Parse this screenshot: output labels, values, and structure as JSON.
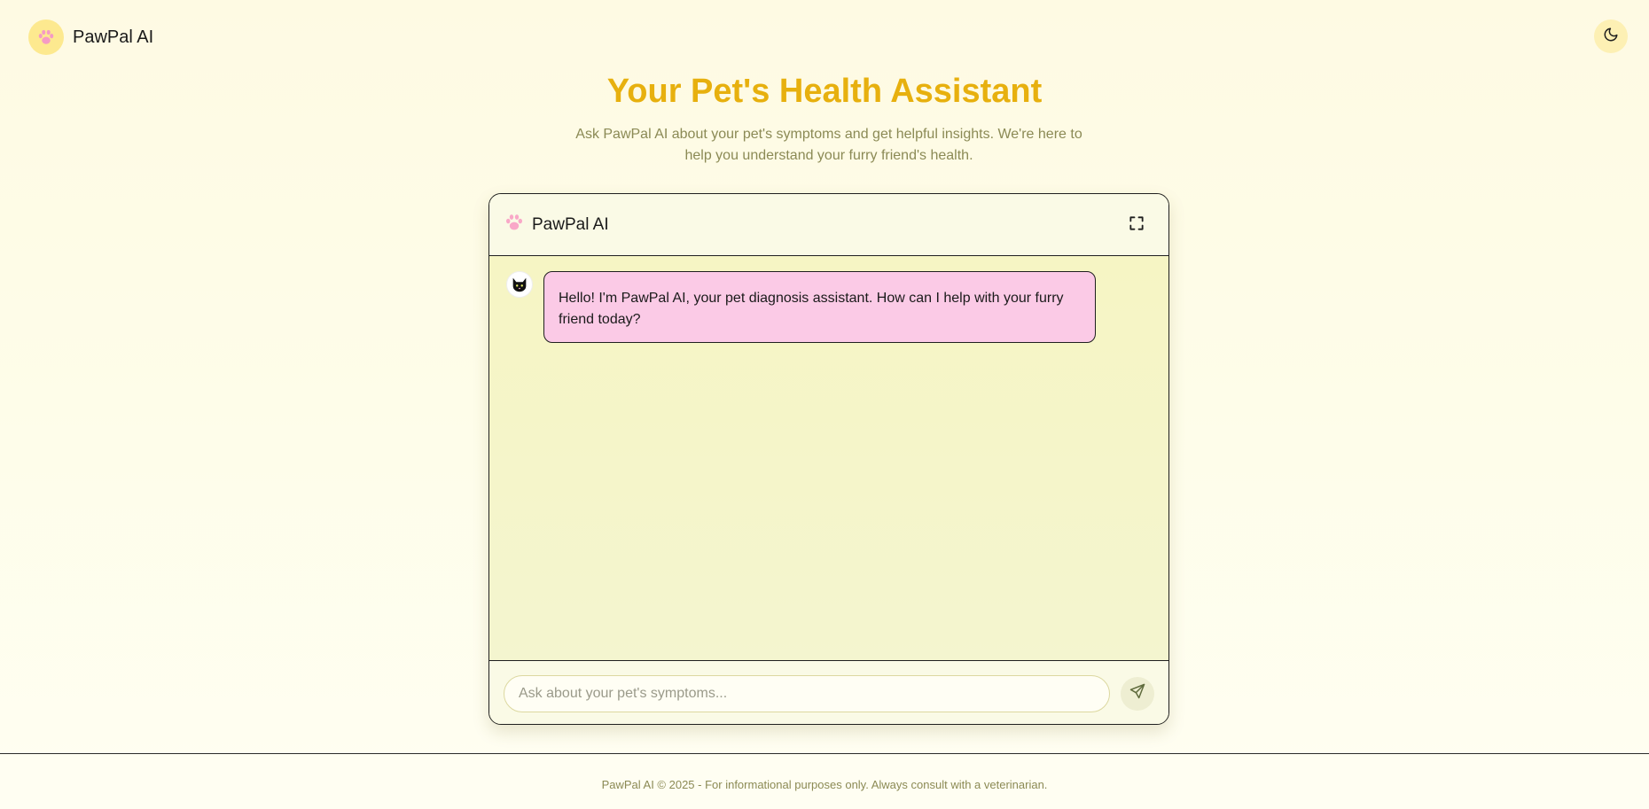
{
  "header": {
    "brand_name": "PawPal AI",
    "brand_icon": "paw-icon",
    "theme_toggle_icon": "moon-icon"
  },
  "hero": {
    "title": "Your Pet's Health Assistant",
    "subtitle": "Ask PawPal AI about your pet's symptoms and get helpful insights. We're here to help you understand your furry friend's health."
  },
  "chat": {
    "title": "PawPal AI",
    "header_icon": "paw-icon",
    "expand_icon": "expand-icon",
    "messages": [
      {
        "sender": "assistant",
        "avatar_icon": "cat-avatar-icon",
        "text": "Hello! I'm PawPal AI, your pet diagnosis assistant. How can I help with your furry friend today?"
      }
    ],
    "input": {
      "placeholder": "Ask about your pet's symptoms...",
      "value": ""
    },
    "send_icon": "send-icon"
  },
  "footer": {
    "text": "PawPal AI © 2025 - For informational purposes only. Always consult with a veterinarian."
  },
  "colors": {
    "accent": "#e7b00e",
    "bubble": "#fbcae6",
    "paw": "#f9a8c8",
    "chat_bg": "#f5f5cb"
  }
}
